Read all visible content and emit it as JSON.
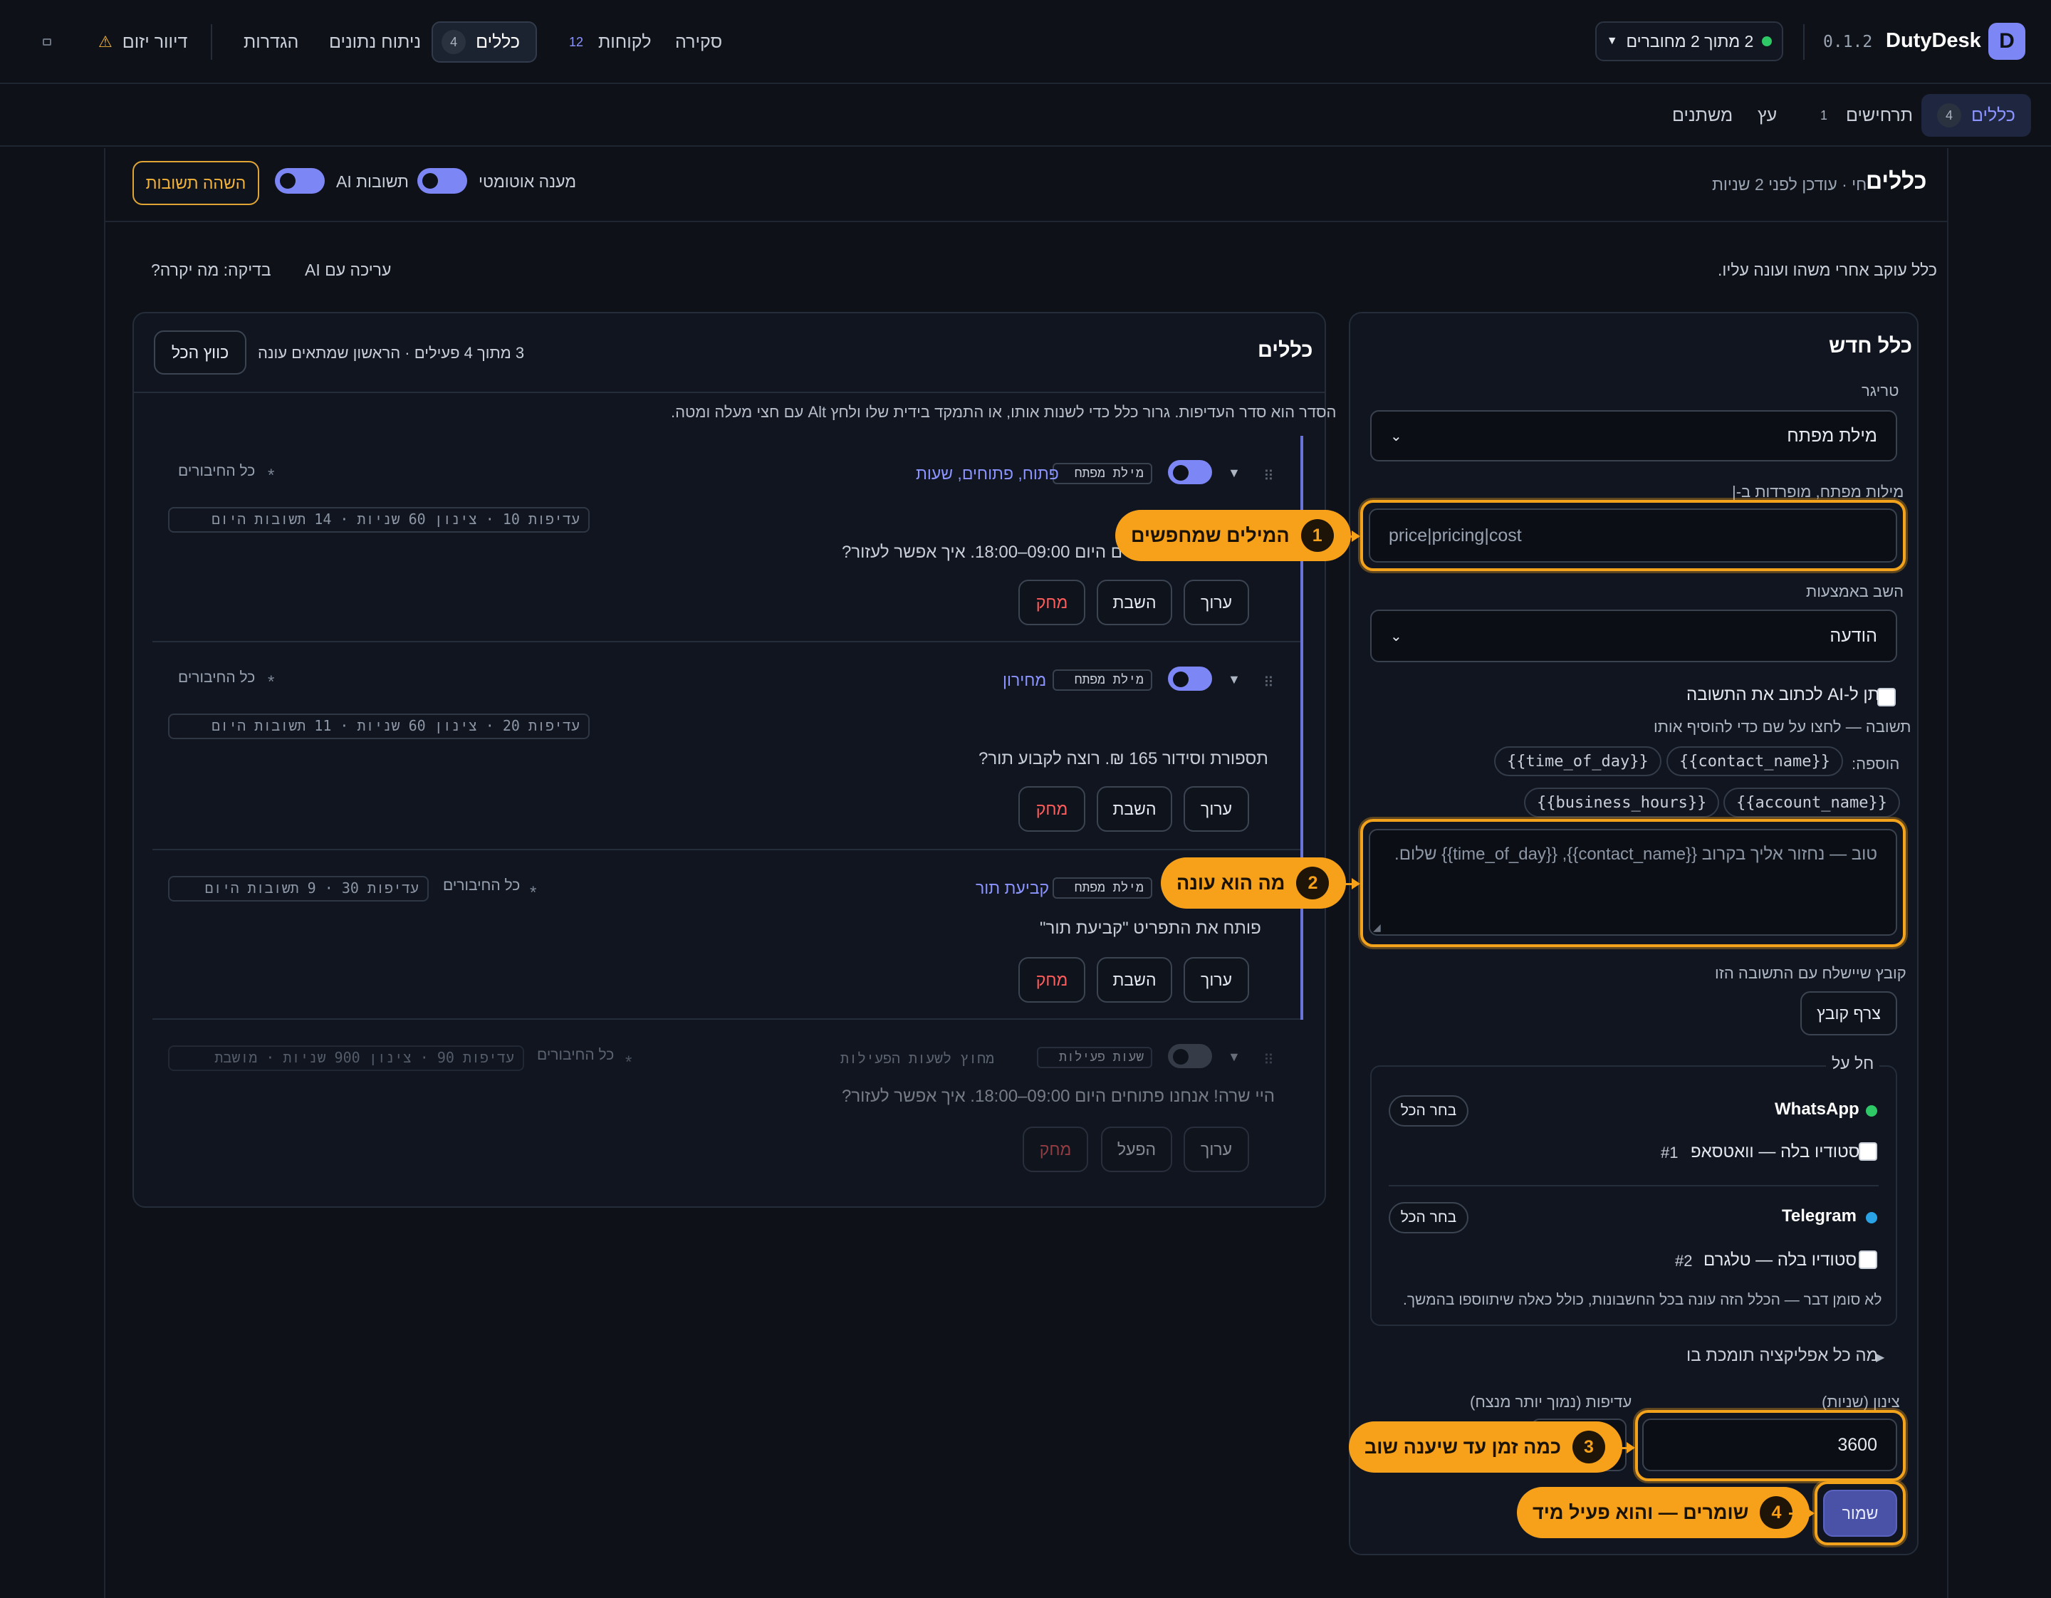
{
  "app": {
    "name": "DutyDesk",
    "version": "0.1.2",
    "logo_letter": "D",
    "status": "2 מתוך 2 מחוברים"
  },
  "nav": {
    "overview": "סקירה",
    "customers": "לקוחות",
    "customers_count": "12",
    "rules": "כללים",
    "rules_count": "4",
    "analytics": "ניתוח נתונים",
    "settings": "הגדרות",
    "proactive": "דיוור יזום"
  },
  "subnav": {
    "rules": "כללים",
    "rules_count": "4",
    "scenarios": "תרחישים",
    "scenarios_count": "1",
    "tree": "עץ",
    "variables": "משתנים"
  },
  "header": {
    "title": "כללים",
    "meta": "חי · עודכן לפני 2 שניות",
    "auto_reply": "מענה אוטומטי",
    "ai_replies": "תשובות AI",
    "pause_button": "השהה תשובות"
  },
  "intro": {
    "description": "כלל עוקב אחרי משהו ועונה עליו.",
    "edit_ai": "עריכה עם AI",
    "test": "בדיקה: מה יקרה?"
  },
  "rules_panel": {
    "title": "כללים",
    "summary": "3 מתוך 4 פעילים · הראשון שמתאים עונה",
    "collapse_all": "כווץ הכל",
    "hint": "הסדר הוא סדר העדיפות. גרור כלל כדי לשנות אותו, או התמקד בידית שלו ולחץ Alt עם חצי מעלה ומטה.",
    "rules": [
      {
        "type": "מילת מפתח",
        "name": "פתוח, פתוחים, שעות",
        "scope": "כל החיבורים",
        "stats": "עדיפות 10 · צינון 60 שניות · 14 תשובות היום",
        "reply": "היי שרה! אנחנו פתוחים היום 09:00–18:00. איך אפשר לעזור?",
        "edit": "ערוך",
        "disable": "השבת",
        "delete": "מחק"
      },
      {
        "type": "מילת מפתח",
        "name": "מחירון",
        "scope": "כל החיבורים",
        "stats": "עדיפות 20 · צינון 60 שניות · 11 תשובות היום",
        "reply": "תספורת וסידור 165 ₪. רוצה לקבוע תור?",
        "edit": "ערוך",
        "disable": "השבת",
        "delete": "מחק"
      },
      {
        "type": "מילת מפתח",
        "name": "קביעת תור",
        "scope": "כל החיבורים",
        "stats": "עדיפות 30 · 9 תשובות היום",
        "reply": "פותח את התפריט \"קביעת תור\"",
        "edit": "ערוך",
        "disable": "השבת",
        "delete": "מחק"
      },
      {
        "type": "שעות פעילות",
        "name": "מחוץ לשעות הפעילות",
        "scope": "כל החיבורים",
        "stats": "עדיפות 90 · צינון 900 שניות · מושבת",
        "reply": "היי שרה! אנחנו פתוחים היום 09:00–18:00. איך אפשר לעזור?",
        "edit": "ערוך",
        "enable": "הפעל",
        "delete": "מחק"
      }
    ]
  },
  "new_rule": {
    "title": "כלל חדש",
    "trigger_label": "טריגר",
    "trigger_value": "מילת מפתח",
    "keywords_label": "מילות מפתח, מופרדות ב-|",
    "keywords_value": "price|pricing|cost",
    "reply_via_label": "השב באמצעות",
    "reply_via_value": "הודעה",
    "ai_write": "תן ל-AI לכתוב את התשובה",
    "reply_label": "תשובה — לחצו על שם כדי להוסיף אותו",
    "insert_label": "הוספה:",
    "vars": [
      "{{contact_name}}",
      "{{time_of_day}}",
      "{{account_name}}",
      "{{business_hours}}"
    ],
    "reply_placeholder": "טוב — נחזור אליך בקרוב {{contact_name}}, {{time_of_day}} שלום.",
    "file_label": "קובץ שיישלח עם התשובה הזו",
    "attach": "צרף קובץ",
    "applies_label": "חל על",
    "channels": [
      {
        "name": "WhatsApp",
        "select_all": "בחר הכל",
        "account": "סטודיו בלה — וואטסאפ",
        "num": "#1",
        "color": "#2ec866"
      },
      {
        "name": "Telegram",
        "select_all": "בחר הכל",
        "account": "סטודיו בלה — טלגרם",
        "num": "#2",
        "color": "#2aa3e6"
      }
    ],
    "none_note": "לא סומן דבר — הכלל הזה עונה בכל החשבונות, כולל כאלה שיתווספו בהמשך.",
    "supports": "מה כל אפליקציה תומכת בו",
    "cooldown_label": "צינון (שניות)",
    "cooldown_value": "3600",
    "priority_label": "עדיפות (נמוך יותר מנצח)",
    "save": "שמור"
  },
  "callouts": [
    {
      "num": "1",
      "text": "המילים שמחפשים"
    },
    {
      "num": "2",
      "text": "מה הוא עונה"
    },
    {
      "num": "3",
      "text": "כמה זמן עד שיענה שוב"
    },
    {
      "num": "4",
      "text": "שומרים — והוא פעיל מיד"
    }
  ],
  "colors": {
    "accent": "#7c86f4",
    "highlight": "#f7a11a",
    "danger": "#ff5c5c",
    "bg": "#0e1218"
  }
}
